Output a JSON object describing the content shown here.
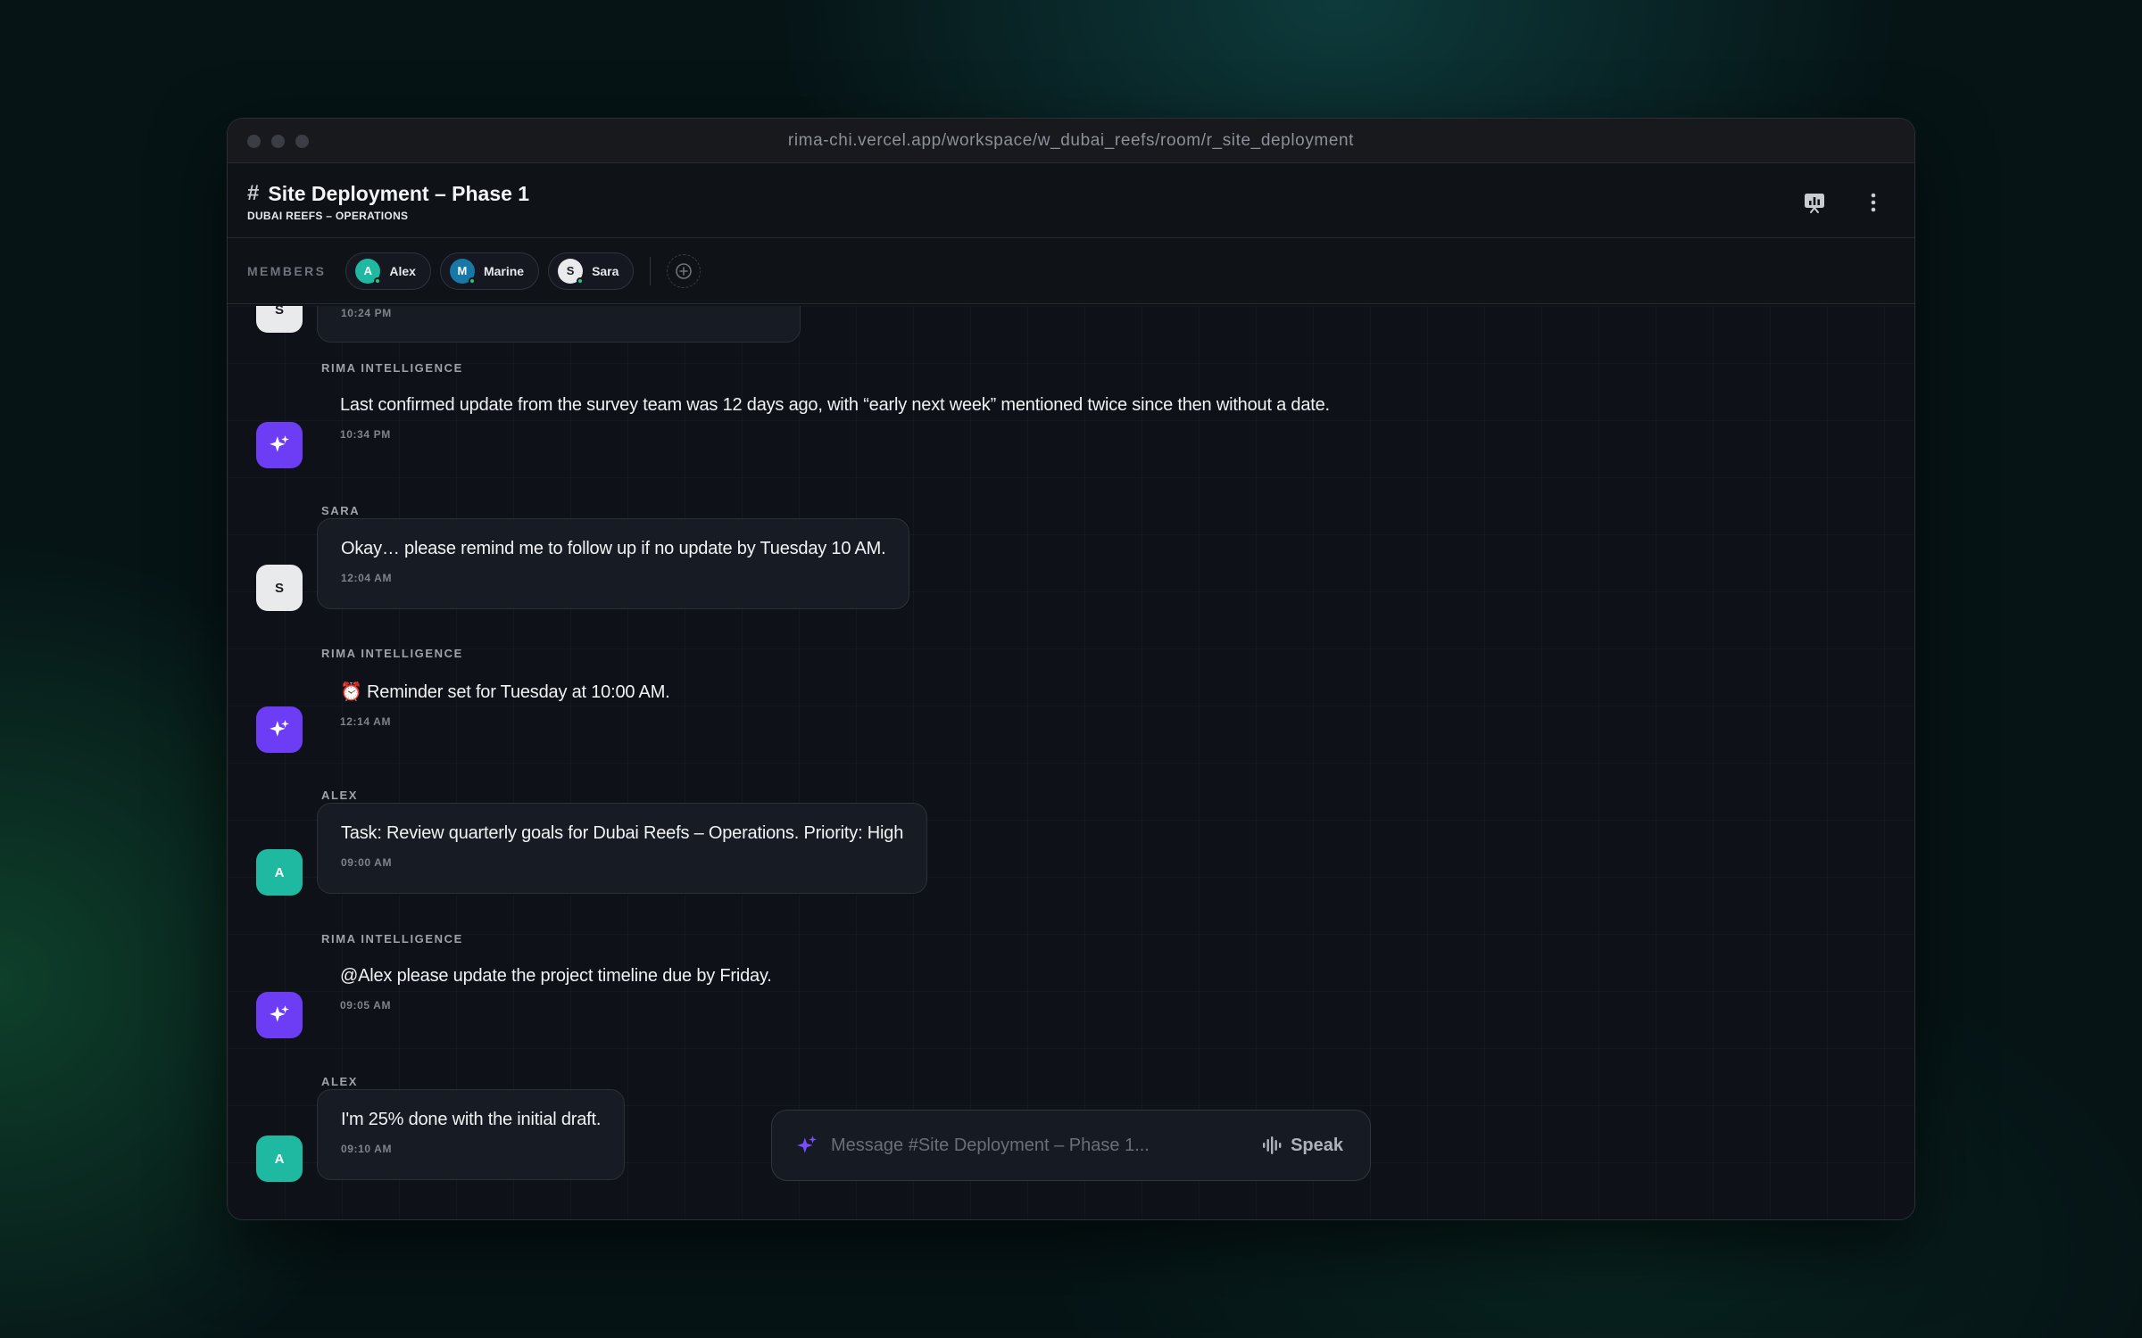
{
  "browser": {
    "url": "rima-chi.vercel.app/workspace/w_dubai_reefs/room/r_site_deployment"
  },
  "header": {
    "hash": "#",
    "title": "Site Deployment – Phase 1",
    "workspace": "DUBAI REEFS – OPERATIONS",
    "icons": [
      "presentation-chart-icon",
      "more-vertical-icon"
    ]
  },
  "members": {
    "label": "MEMBERS",
    "list": [
      {
        "initial": "A",
        "name": "Alex",
        "color": "#1fb8a0",
        "status": "online"
      },
      {
        "initial": "M",
        "name": "Marine",
        "color": "#1778a8",
        "status": "online"
      },
      {
        "initial": "S",
        "name": "Sara",
        "color": "#e9eaec",
        "status": "online"
      }
    ],
    "add_icon": "plus-circle-icon"
  },
  "messages": [
    {
      "sender": "",
      "avatar": "S",
      "kind": "bubble",
      "text": "",
      "time": "10:24 PM"
    },
    {
      "sender": "RIMA INTELLIGENCE",
      "avatar": "ai",
      "kind": "plain",
      "text": "Last confirmed update from the survey team was 12 days ago, with “early next week” mentioned twice since then without a date.",
      "time": "10:34 PM"
    },
    {
      "sender": "SARA",
      "avatar": "S",
      "kind": "bubble",
      "text": "Okay… please remind me to follow up if no update by Tuesday 10 AM.",
      "time": "12:04 AM"
    },
    {
      "sender": "RIMA INTELLIGENCE",
      "avatar": "ai",
      "kind": "plain",
      "text": "⏰ Reminder set for Tuesday at 10:00 AM.",
      "time": "12:14 AM"
    },
    {
      "sender": "ALEX",
      "avatar": "A",
      "kind": "bubble",
      "text": "Task: Review quarterly goals for Dubai Reefs – Operations. Priority: High",
      "time": "09:00 AM"
    },
    {
      "sender": "RIMA INTELLIGENCE",
      "avatar": "ai",
      "kind": "plain",
      "text": "@Alex please update the project timeline due by Friday.",
      "time": "09:05 AM"
    },
    {
      "sender": "ALEX",
      "avatar": "A",
      "kind": "bubble",
      "text": "I'm 25% done with the initial draft.",
      "time": "09:10 AM"
    }
  ],
  "composer": {
    "placeholder": "Message #Site Deployment – Phase 1...",
    "speak_label": "Speak",
    "ai_icon": "sparkle-icon",
    "voice_icon": "waveform-icon"
  },
  "colors": {
    "accent": "#6d3df5",
    "online": "#2ec27e",
    "alex": "#1fb8a0"
  }
}
